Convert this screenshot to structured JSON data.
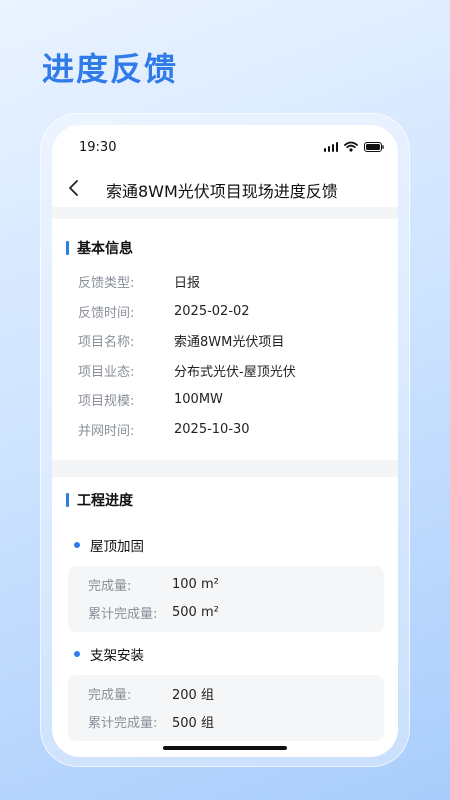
{
  "promo": {
    "title": "进度反馈"
  },
  "status_bar": {
    "time": "19:30"
  },
  "nav": {
    "title": "索通8WM光伏项目现场进度反馈"
  },
  "basic_info": {
    "title": "基本信息",
    "rows": [
      {
        "label": "反馈类型:",
        "value": "日报"
      },
      {
        "label": "反馈时间:",
        "value": "2025-02-02"
      },
      {
        "label": "项目名称:",
        "value": "索通8WM光伏项目"
      },
      {
        "label": "项目业态:",
        "value": "分布式光伏-屋顶光伏"
      },
      {
        "label": "项目规模:",
        "value": "100MW"
      },
      {
        "label": "并网时间:",
        "value": "2025-10-30"
      }
    ]
  },
  "progress": {
    "title": "工程进度",
    "tasks": [
      {
        "name": "屋顶加固",
        "rows": [
          {
            "label": "完成量:",
            "value": "100 m²"
          },
          {
            "label": "累计完成量:",
            "value": "500 m²"
          }
        ]
      },
      {
        "name": "支架安装",
        "rows": [
          {
            "label": "完成量:",
            "value": "200 组"
          },
          {
            "label": "累计完成量:",
            "value": "500 组"
          }
        ]
      }
    ]
  },
  "colors": {
    "accent": "#2f7bea"
  }
}
